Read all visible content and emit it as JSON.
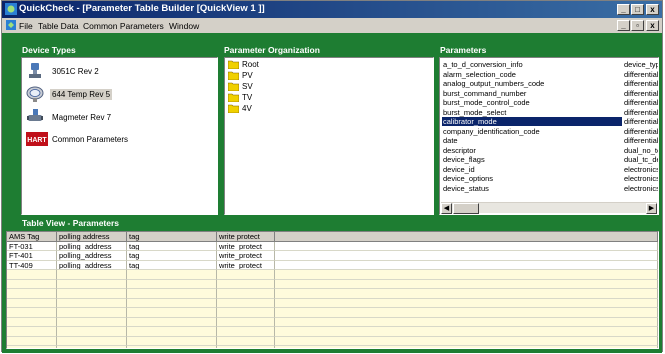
{
  "window": {
    "title": "QuickCheck - [Parameter Table Builder [QuickView 1 ]]",
    "controls": {
      "minimize": "_",
      "maximize": "□",
      "close": "x",
      "child_minimize": "_",
      "child_restore": "▫",
      "child_close": "x"
    }
  },
  "menu": {
    "items": [
      "File",
      "Table Data",
      "Common Parameters",
      "Window"
    ]
  },
  "sections": {
    "device_types": "Device Types",
    "parameter_organization": "Parameter Organization",
    "parameters": "Parameters",
    "table_view": "Table View - Parameters"
  },
  "device_types": [
    {
      "label": "3051C Rev 2",
      "icon": "pressure-transmitter-icon",
      "selected": false
    },
    {
      "label": "644 Temp Rev 5",
      "icon": "temperature-transmitter-icon",
      "selected": true
    },
    {
      "label": "Magmeter Rev 7",
      "icon": "magmeter-icon",
      "selected": false
    },
    {
      "label": "Common Parameters",
      "icon": "hart-logo-icon",
      "badge": "HART",
      "selected": false
    }
  ],
  "parameter_organization": [
    "Root",
    "PV",
    "SV",
    "TV",
    "4V"
  ],
  "parameters": [
    {
      "name": "a_to_d_conversion_info",
      "category": "device_typ"
    },
    {
      "name": "alarm_selection_code",
      "category": "differential_"
    },
    {
      "name": "analog_output_numbers_code",
      "category": "differential_"
    },
    {
      "name": "burst_command_number",
      "category": "differential_"
    },
    {
      "name": "burst_mode_control_code",
      "category": "differential_"
    },
    {
      "name": "burst_mode_select",
      "category": "differential_"
    },
    {
      "name": "calibrator_mode",
      "category": "differential_",
      "selected": true
    },
    {
      "name": "company_identification_code",
      "category": "differential_"
    },
    {
      "name": "date",
      "category": "differential_"
    },
    {
      "name": "descriptor",
      "category": "dual_no_tc"
    },
    {
      "name": "device_flags",
      "category": "dual_tc_de"
    },
    {
      "name": "device_id",
      "category": "electronics"
    },
    {
      "name": "device_options",
      "category": "electronics"
    },
    {
      "name": "device_status",
      "category": "electronics"
    }
  ],
  "table": {
    "columns": [
      "AMS Tag",
      "polling address",
      "tag",
      "write protect"
    ],
    "rows": [
      [
        "FT-031",
        "polling_address",
        "tag",
        "write_protect"
      ],
      [
        "FT-401",
        "polling_address",
        "tag",
        "write_protect"
      ],
      [
        "TT-409",
        "polling_address",
        "tag",
        "write_protect"
      ]
    ]
  },
  "colors": {
    "client_background": "#1e7d32",
    "title_bar": "#0a246a",
    "selection": "#0a246a",
    "grid_filler": "#fffbdc"
  }
}
